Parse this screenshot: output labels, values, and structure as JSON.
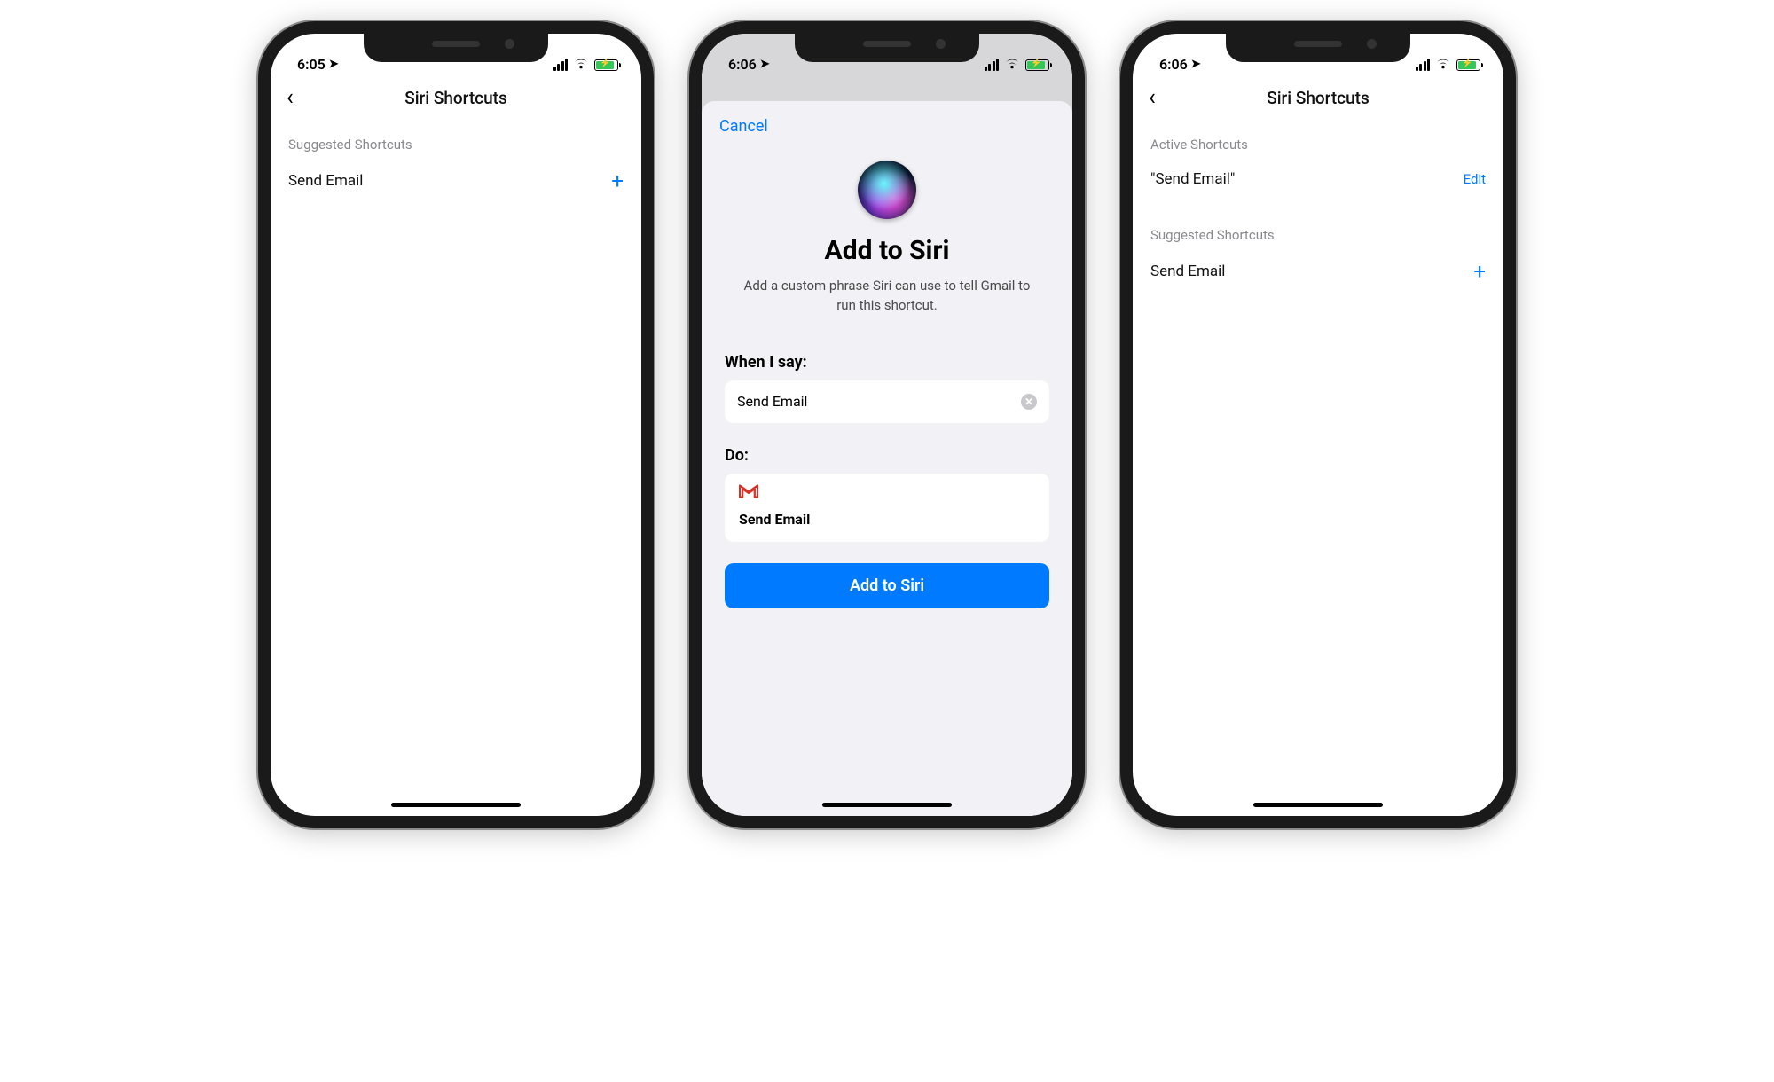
{
  "phones": {
    "left": {
      "status": {
        "time": "6:05"
      },
      "nav_title": "Siri Shortcuts",
      "sections": {
        "suggested": {
          "label": "Suggested Shortcuts",
          "items": [
            {
              "label": "Send Email",
              "action_glyph": "+"
            }
          ]
        }
      }
    },
    "middle": {
      "status": {
        "time": "6:06"
      },
      "sheet": {
        "cancel_label": "Cancel",
        "title": "Add to Siri",
        "subtitle": "Add a custom phrase Siri can use to tell Gmail to run this shortcut.",
        "when_label": "When I say:",
        "phrase_value": "Send Email",
        "do_label": "Do:",
        "action_app": "Gmail",
        "action_label": "Send Email",
        "primary_button": "Add to Siri"
      }
    },
    "right": {
      "status": {
        "time": "6:06"
      },
      "nav_title": "Siri Shortcuts",
      "sections": {
        "active": {
          "label": "Active Shortcuts",
          "items": [
            {
              "label": "\"Send Email\"",
              "edit_label": "Edit"
            }
          ]
        },
        "suggested": {
          "label": "Suggested Shortcuts",
          "items": [
            {
              "label": "Send Email",
              "action_glyph": "+"
            }
          ]
        }
      }
    }
  }
}
